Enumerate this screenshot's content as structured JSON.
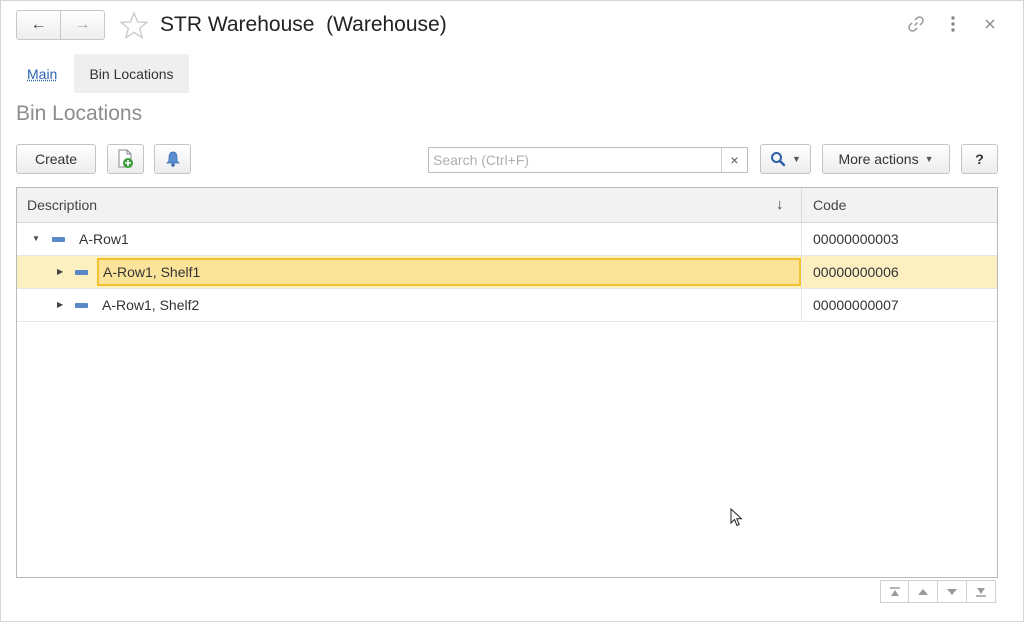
{
  "window": {
    "title": "STR Warehouse  (Warehouse)",
    "back_icon": "←",
    "forward_icon": "→"
  },
  "tabs": [
    {
      "label": "Main"
    },
    {
      "label": "Bin Locations"
    }
  ],
  "section_title": "Bin Locations",
  "toolbar": {
    "create_label": "Create",
    "search_placeholder": "Search (Ctrl+F)",
    "search_clear": "×",
    "more_actions_label": "More actions",
    "help_label": "?"
  },
  "table": {
    "columns": [
      {
        "label": "Description",
        "sort_icon": "↓"
      },
      {
        "label": "Code"
      }
    ],
    "rows": [
      {
        "description": "A-Row1",
        "code": "00000000003",
        "level": 0,
        "expanded": true
      },
      {
        "description": "A-Row1, Shelf1",
        "code": "00000000006",
        "level": 1,
        "expanded": false,
        "selected": true
      },
      {
        "description": "A-Row1, Shelf2",
        "code": "00000000007",
        "level": 1,
        "expanded": false
      }
    ]
  },
  "colors": {
    "selection_row": "#fcefc0",
    "selection_cell": "#fbe49a",
    "focus_border": "#f2c230",
    "link": "#2b65b4",
    "group_icon": "#5a87c5"
  },
  "icons": [
    "back-arrow-icon",
    "forward-arrow-icon",
    "star-icon",
    "link-icon",
    "more-vertical-icon",
    "close-icon",
    "add-document-icon",
    "bell-icon",
    "search-icon",
    "cursor-icon"
  ]
}
